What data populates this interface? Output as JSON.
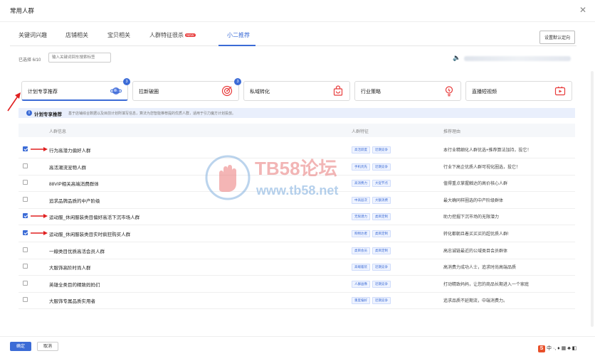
{
  "dialog": {
    "title": "常用人群"
  },
  "tabs": [
    {
      "label": "关键词兴趣"
    },
    {
      "label": "店铺相关"
    },
    {
      "label": "宝贝相关"
    },
    {
      "label": "人群特征很杀",
      "badge": "NEW"
    },
    {
      "label": "小二推荐",
      "active": true
    }
  ],
  "set_default_label": "设置默认定向",
  "selected_count": "已选择 6/10",
  "search": {
    "placeholder": "输入关键词回车搜索标签"
  },
  "category_cards": [
    {
      "label": "计划专享推荐",
      "count": "3",
      "active": true,
      "icon": "planet-icon"
    },
    {
      "label": "拉新破圈",
      "count": "3",
      "icon": "target-icon"
    },
    {
      "label": "私域转化",
      "count": "",
      "icon": "bag-icon"
    },
    {
      "label": "行业策略",
      "count": "",
      "icon": "bulb-icon"
    },
    {
      "label": "直播短视频",
      "count": "",
      "icon": "video-icon"
    }
  ],
  "info": {
    "title": "计划专享推荐",
    "desc": "基于店铺综合数据以及目前计划所填写信息，算法为您智能推荐提的优质人群，适用于引力魔方计划投放。"
  },
  "table": {
    "headers": [
      "人群信息",
      "人群特征",
      "推荐理由"
    ],
    "rows": [
      {
        "checked": true,
        "arrow": true,
        "name": "行为高潜力偏好人群",
        "tags": [
          "高活跃度",
          "近期竞争"
        ],
        "reason": "本行业精细化人群优选+推荐算法加持，投它！"
      },
      {
        "checked": false,
        "arrow": false,
        "name": "高活潮流宠物人群",
        "tags": [
          "手机优先",
          "近期竞争"
        ],
        "reason": "行业下高企优质人群可视化圈选，投它！"
      },
      {
        "checked": false,
        "arrow": false,
        "name": "88VIP相关高端消费群体",
        "tags": [
          "高消费力",
          "大促节点"
        ],
        "reason": "值得重点掌握触达的高价核心人群"
      },
      {
        "checked": false,
        "arrow": false,
        "name": "追求品牌品质的中产阶级",
        "tags": [
          "中高层次",
          "大额消费"
        ],
        "reason": "最大确同样圈选的中产阶级群体"
      },
      {
        "checked": true,
        "arrow": true,
        "name": "运动服_休闲服装类目偏好高活下沉市场人群",
        "tags": [
          "无限潜力",
          "类目定制"
        ],
        "reason": "助力挖掘下沉市场的无限潜力"
      },
      {
        "checked": true,
        "arrow": true,
        "name": "运动服_休闲服装类目实时疯狂购买人群",
        "tags": [
          "购物达者",
          "类目定制"
        ],
        "reason": "转化都朝且着买买买的超优质人群!"
      },
      {
        "checked": false,
        "arrow": false,
        "name": "一線类目优质高活会员人群",
        "tags": [
          "类目会员",
          "类目定制"
        ],
        "reason": "高忠诚链最近的公域类目会员群体"
      },
      {
        "checked": false,
        "arrow": false,
        "name": "大服饰高阶时尚人群",
        "tags": [
          "高端着装",
          "近期竞争"
        ],
        "reason": "高消费力成功人士，追求时尚高端品质"
      },
      {
        "checked": false,
        "arrow": false,
        "name": "英雄全类目的精致妈妈们",
        "tags": [
          "人群画像",
          "近期竞争"
        ],
        "reason": "打动精致妈妈，让您的商品长期进入一个家庭"
      },
      {
        "checked": false,
        "arrow": false,
        "name": "大服饰专属品质实用者",
        "tags": [
          "重度偏好",
          "近期竞争"
        ],
        "reason": "追求品质不延期流，中端消费力。"
      }
    ]
  },
  "watermark": {
    "brand": "TB58论坛",
    "url": "www.tb58.net"
  },
  "footer": {
    "confirm_label": "确定",
    "cancel_label": "取消"
  },
  "ime": {
    "label": "中 ·, ♦ ▦ ♣ ◧"
  },
  "colors": {
    "accent": "#3b6bd6",
    "red": "#e83c3c"
  }
}
